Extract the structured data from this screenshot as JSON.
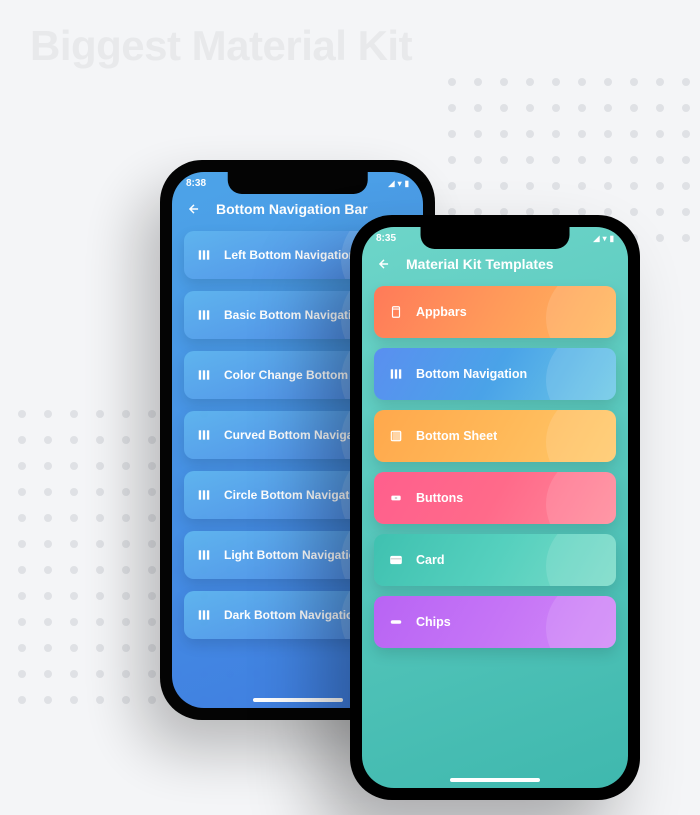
{
  "page_heading": "Biggest Material Kit",
  "phone_back": {
    "status_time": "8:38",
    "app_title": "Bottom Navigation Bar",
    "items": [
      {
        "label": "Left Bottom Navigation"
      },
      {
        "label": "Basic Bottom Navigation"
      },
      {
        "label": "Color Change Bottom Nav"
      },
      {
        "label": "Curved Bottom Navigation"
      },
      {
        "label": "Circle Bottom Navigation"
      },
      {
        "label": "Light Bottom Navigation"
      },
      {
        "label": "Dark Bottom Navigation"
      }
    ]
  },
  "phone_front": {
    "status_time": "8:35",
    "app_title": "Material Kit Templates",
    "items": [
      {
        "label": "Appbars",
        "icon": "appbars-icon",
        "gradient": "grad-orange"
      },
      {
        "label": "Bottom Navigation",
        "icon": "bottom-nav-icon",
        "gradient": "grad-blue"
      },
      {
        "label": "Bottom Sheet",
        "icon": "bottom-sheet-icon",
        "gradient": "grad-amber"
      },
      {
        "label": "Buttons",
        "icon": "buttons-icon",
        "gradient": "grad-pink"
      },
      {
        "label": "Card",
        "icon": "card-icon",
        "gradient": "grad-teal"
      },
      {
        "label": "Chips",
        "icon": "chips-icon",
        "gradient": "grad-purple"
      }
    ]
  }
}
